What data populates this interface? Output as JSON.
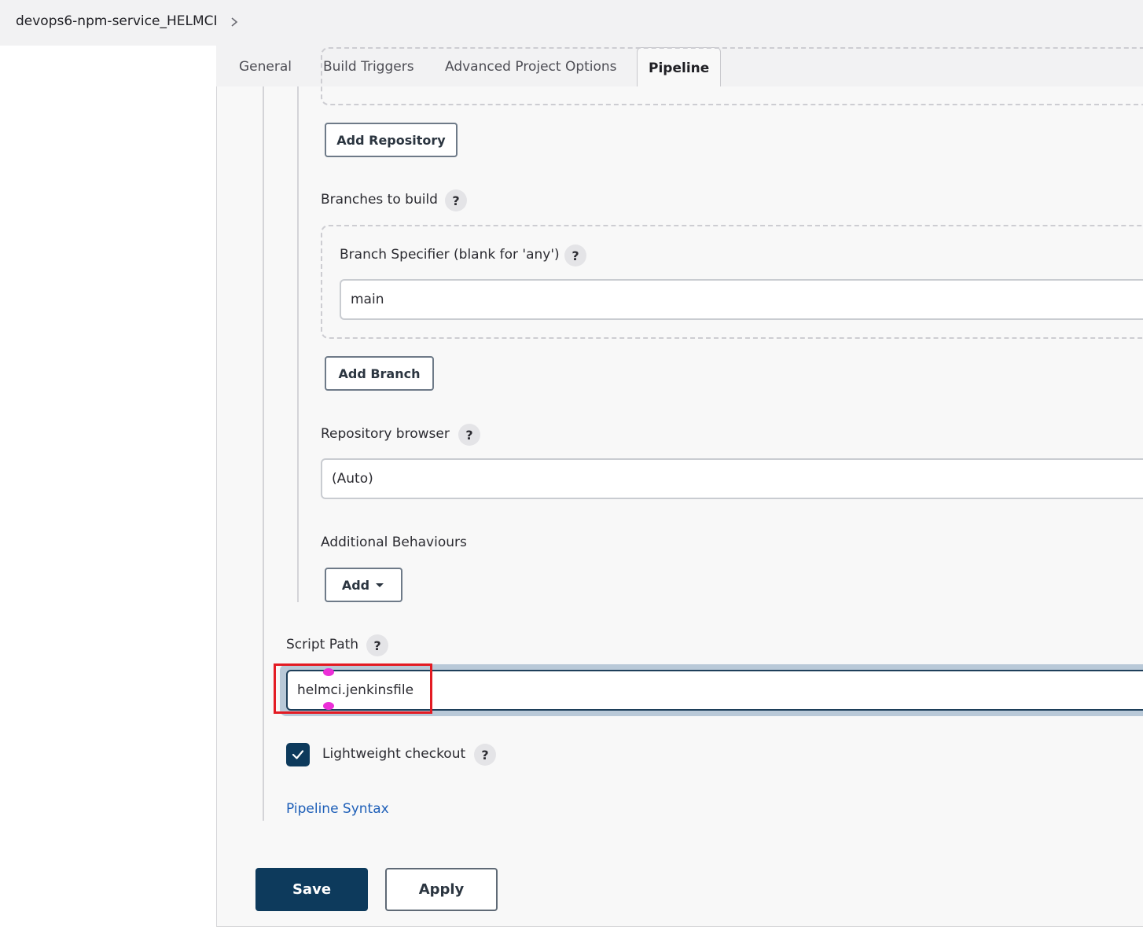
{
  "breadcrumb": {
    "project": "devops6-npm-service_HELMCI"
  },
  "tabs": [
    {
      "label": "General"
    },
    {
      "label": "Build Triggers"
    },
    {
      "label": "Advanced Project Options"
    },
    {
      "label": "Pipeline",
      "active": true
    }
  ],
  "scm": {
    "add_repository_label": "Add Repository",
    "branches_label": "Branches to build",
    "branch_specifier_label": "Branch Specifier (blank for 'any')",
    "branch_specifier_value": "main",
    "add_branch_label": "Add Branch",
    "repo_browser_label": "Repository browser",
    "repo_browser_value": "(Auto)",
    "additional_behaviours_label": "Additional Behaviours",
    "add_label": "Add"
  },
  "pipeline": {
    "script_path_label": "Script Path",
    "script_path_value": "helmci.jenkinsfile",
    "lightweight_label": "Lightweight checkout",
    "lightweight_checked": true,
    "syntax_link": "Pipeline Syntax"
  },
  "actions": {
    "save_label": "Save",
    "apply_label": "Apply"
  },
  "help_glyph": "?",
  "colors": {
    "primary": "#0d3a5c",
    "link": "#1e5fb8",
    "highlight": "#e31b23",
    "marker": "#ec2fd8"
  }
}
